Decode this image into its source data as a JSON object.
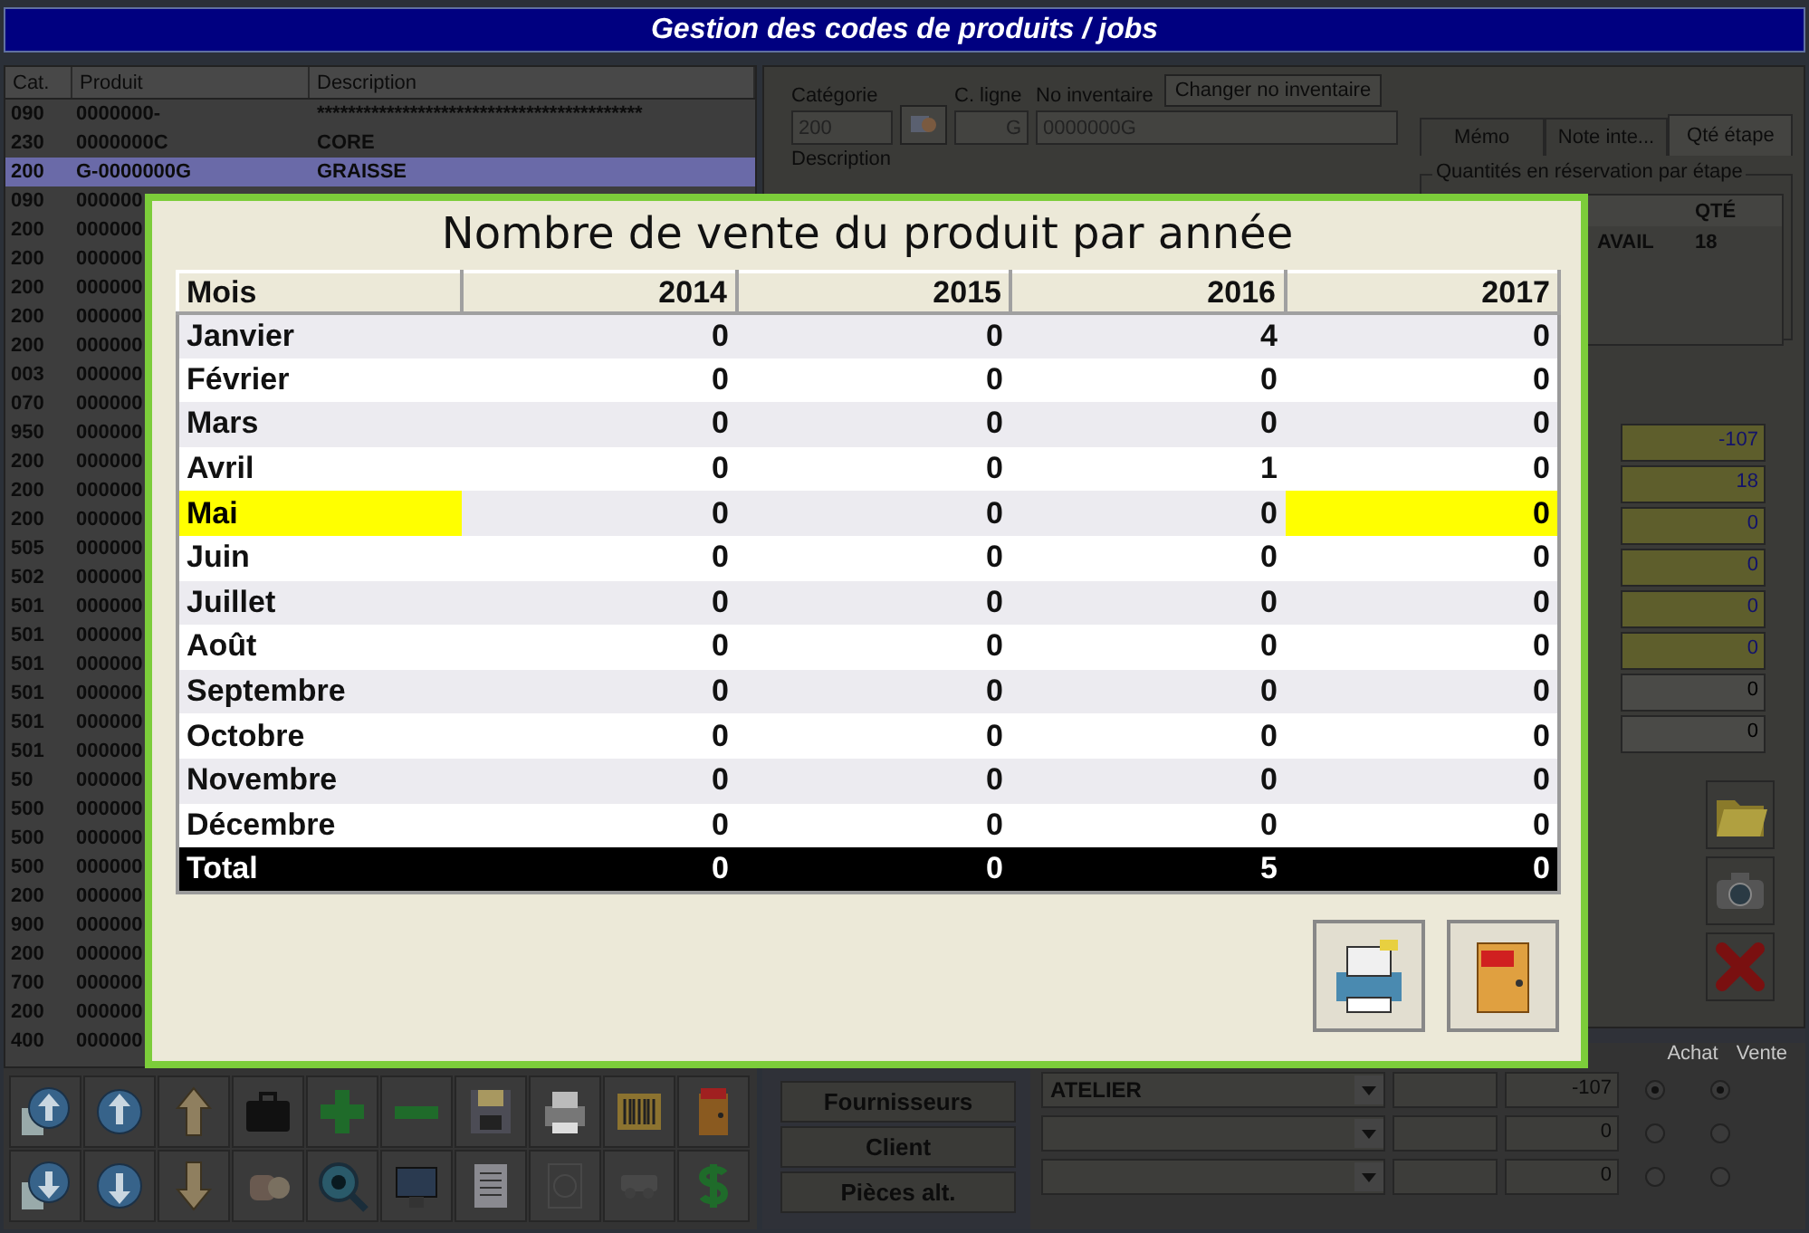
{
  "window": {
    "title": "Gestion des codes de produits / jobs"
  },
  "product_list": {
    "columns": [
      "Cat.",
      "Produit",
      "Description"
    ],
    "rows": [
      {
        "cat": "090",
        "produit": "0000000-",
        "description": "******************************************",
        "selected": false
      },
      {
        "cat": "230",
        "produit": "0000000C",
        "description": "CORE",
        "selected": false
      },
      {
        "cat": "200",
        "produit": "G-0000000G",
        "description": "GRAISSE",
        "selected": true
      },
      {
        "cat": "090",
        "produit": "000000",
        "selected": false
      },
      {
        "cat": "200",
        "produit": "000000",
        "selected": false
      },
      {
        "cat": "200",
        "produit": "000000",
        "selected": false
      },
      {
        "cat": "200",
        "produit": "000000",
        "selected": false
      },
      {
        "cat": "200",
        "produit": "000000",
        "selected": false
      },
      {
        "cat": "200",
        "produit": "000000",
        "selected": false
      },
      {
        "cat": "003",
        "produit": "000000",
        "selected": false
      },
      {
        "cat": "070",
        "produit": "000000",
        "selected": false
      },
      {
        "cat": "950",
        "produit": "000000",
        "selected": false
      },
      {
        "cat": "200",
        "produit": "000000",
        "selected": false
      },
      {
        "cat": "200",
        "produit": "000000",
        "selected": false
      },
      {
        "cat": "200",
        "produit": "000000",
        "selected": false
      },
      {
        "cat": "505",
        "produit": "000000",
        "selected": false
      },
      {
        "cat": "502",
        "produit": "000000",
        "selected": false
      },
      {
        "cat": "501",
        "produit": "000000",
        "selected": false
      },
      {
        "cat": "501",
        "produit": "000000",
        "selected": false
      },
      {
        "cat": "501",
        "produit": "000000",
        "selected": false
      },
      {
        "cat": "501",
        "produit": "000000",
        "selected": false
      },
      {
        "cat": "501",
        "produit": "000000",
        "selected": false
      },
      {
        "cat": "501",
        "produit": "000000",
        "selected": false
      },
      {
        "cat": "50",
        "produit": "000000",
        "selected": false
      },
      {
        "cat": "500",
        "produit": "000000",
        "selected": false
      },
      {
        "cat": "500",
        "produit": "000000",
        "selected": false
      },
      {
        "cat": "500",
        "produit": "000000",
        "selected": false
      },
      {
        "cat": "200",
        "produit": "000000",
        "selected": false
      },
      {
        "cat": "900",
        "produit": "000000",
        "selected": false
      },
      {
        "cat": "200",
        "produit": "000000",
        "selected": false
      },
      {
        "cat": "700",
        "produit": "000000",
        "selected": false
      },
      {
        "cat": "200",
        "produit": "000000",
        "selected": false
      },
      {
        "cat": "400",
        "produit": "000000",
        "selected": false
      }
    ]
  },
  "toolbar": {
    "buttons": [
      {
        "disabled": false
      },
      {
        "disabled": false
      },
      {
        "disabled": false
      },
      {
        "disabled": false
      },
      {
        "disabled": false
      },
      {
        "disabled": false
      },
      {
        "disabled": false
      },
      {
        "disabled": false
      },
      {
        "disabled": false
      },
      {
        "disabled": false
      },
      {
        "disabled": false
      },
      {
        "disabled": false
      },
      {
        "disabled": false
      },
      {
        "disabled": false
      },
      {
        "disabled": false
      },
      {
        "disabled": false
      },
      {
        "disabled": false
      },
      {
        "disabled": true
      },
      {
        "disabled": true
      },
      {
        "disabled": false
      }
    ]
  },
  "product_form": {
    "category_label": "Catégorie",
    "category": "200",
    "line_label": "C. ligne",
    "line": "G",
    "inventory_label": "No inventaire",
    "inventory": "0000000G",
    "change_inventory_button": "Changer no inventaire",
    "description_label": "Description"
  },
  "tabs": [
    {
      "label": "Mémo",
      "selected": false
    },
    {
      "label": "Note inte...",
      "selected": false
    },
    {
      "label": "Qté étape",
      "selected": true
    }
  ],
  "reservation": {
    "title": "Quantités en réservation par étape",
    "qty_column": "QTÉ",
    "rows": [
      {
        "step": "AVAIL",
        "qty": "18"
      }
    ]
  },
  "quantity_fields": [
    {
      "value": "-107",
      "highlighted": true
    },
    {
      "value": "18",
      "highlighted": true
    },
    {
      "value": "0",
      "highlighted": true
    },
    {
      "value": "0",
      "highlighted": true
    },
    {
      "value": "0",
      "highlighted": true
    },
    {
      "value": "0",
      "highlighted": true
    },
    {
      "value": "0",
      "highlighted": false
    },
    {
      "value": "0",
      "highlighted": false
    }
  ],
  "link_buttons": [
    "Fournisseurs",
    "Client",
    "Pièces alt."
  ],
  "stock_rows": {
    "columns": [
      "Achat",
      "Vente"
    ],
    "rows": [
      {
        "location": "ATELIER",
        "quantity": "-107",
        "achat_selected": true,
        "vente_selected": true
      },
      {
        "quantity": "0",
        "achat_selected": false,
        "vente_selected": false
      },
      {
        "quantity": "0",
        "achat_selected": false,
        "vente_selected": false
      }
    ]
  },
  "sales_dialog": {
    "title": "Nombre de vente du produit par année",
    "columns": [
      {
        "label": "Mois",
        "current": true
      },
      {
        "label": "2014",
        "current": false
      },
      {
        "label": "2015",
        "current": false
      },
      {
        "label": "2016",
        "current": false
      },
      {
        "label": "2017",
        "current": true
      }
    ],
    "rows": [
      {
        "kind": "month",
        "current": false,
        "cells": [
          "Janvier",
          "0",
          "0",
          "4",
          "0"
        ]
      },
      {
        "kind": "month",
        "current": false,
        "cells": [
          "Février",
          "0",
          "0",
          "0",
          "0"
        ]
      },
      {
        "kind": "month",
        "current": false,
        "cells": [
          "Mars",
          "0",
          "0",
          "0",
          "0"
        ]
      },
      {
        "kind": "month",
        "current": false,
        "cells": [
          "Avril",
          "0",
          "0",
          "1",
          "0"
        ]
      },
      {
        "kind": "month",
        "current": true,
        "cells": [
          "Mai",
          "0",
          "0",
          "0",
          "0"
        ]
      },
      {
        "kind": "month",
        "current": false,
        "cells": [
          "Juin",
          "0",
          "0",
          "0",
          "0"
        ]
      },
      {
        "kind": "month",
        "current": false,
        "cells": [
          "Juillet",
          "0",
          "0",
          "0",
          "0"
        ]
      },
      {
        "kind": "month",
        "current": false,
        "cells": [
          "Août",
          "0",
          "0",
          "0",
          "0"
        ]
      },
      {
        "kind": "month",
        "current": false,
        "cells": [
          "Septembre",
          "0",
          "0",
          "0",
          "0"
        ]
      },
      {
        "kind": "month",
        "current": false,
        "cells": [
          "Octobre",
          "0",
          "0",
          "0",
          "0"
        ]
      },
      {
        "kind": "month",
        "current": false,
        "cells": [
          "Novembre",
          "0",
          "0",
          "0",
          "0"
        ]
      },
      {
        "kind": "month",
        "current": false,
        "cells": [
          "Décembre",
          "0",
          "0",
          "0",
          "0"
        ]
      },
      {
        "kind": "total",
        "cells": [
          "Total",
          "0",
          "0",
          "5",
          "0"
        ]
      }
    ]
  }
}
